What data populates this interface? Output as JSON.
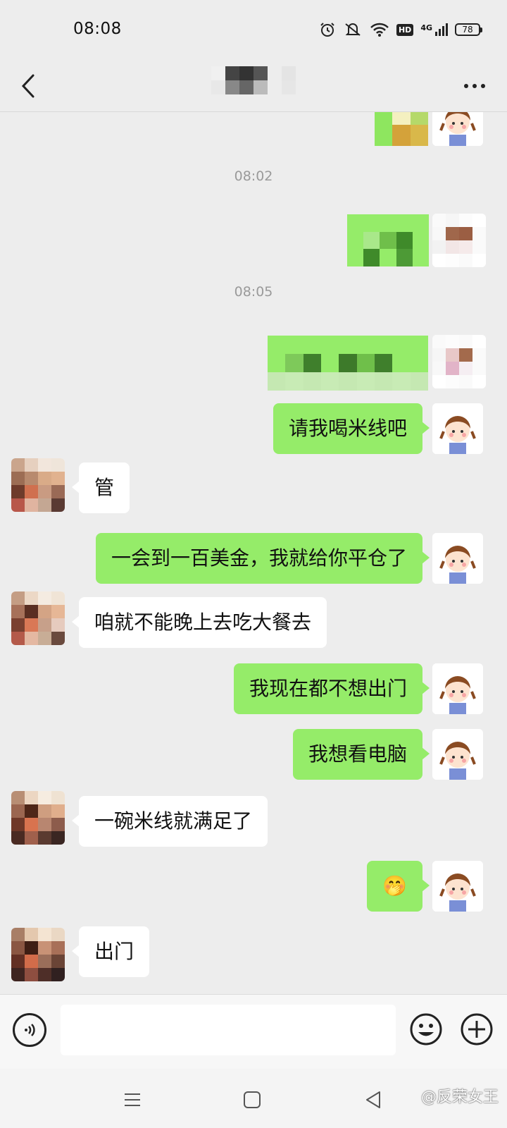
{
  "status_bar": {
    "time": "08:08",
    "battery": "78",
    "network": "4G",
    "hd": "HD",
    "icons": [
      "alarm-icon",
      "mute-icon",
      "wifi-icon",
      "hd-icon",
      "signal-icon",
      "battery-icon"
    ]
  },
  "nav": {
    "back_icon": "chevron-left-icon",
    "title": "",
    "more_icon": "more-icon"
  },
  "timestamps": [
    "08:02",
    "08:05"
  ],
  "messages": [
    {
      "side": "out",
      "type": "sticker",
      "text": ""
    },
    {
      "side": "out",
      "type": "sticker",
      "text": ""
    },
    {
      "side": "out",
      "type": "sticker",
      "text": ""
    },
    {
      "side": "out",
      "type": "text",
      "text": "请我喝米线吧"
    },
    {
      "side": "in",
      "type": "text",
      "text": "管"
    },
    {
      "side": "out",
      "type": "text",
      "text": "一会到一百美金，我就给你平仓了"
    },
    {
      "side": "in",
      "type": "text",
      "text": "咱就不能晚上去吃大餐去"
    },
    {
      "side": "out",
      "type": "text",
      "text": "我现在都不想出门"
    },
    {
      "side": "out",
      "type": "text",
      "text": "我想看电脑"
    },
    {
      "side": "in",
      "type": "text",
      "text": "一碗米线就满足了"
    },
    {
      "side": "out",
      "type": "emoji",
      "text": "🤭"
    },
    {
      "side": "in",
      "type": "text",
      "text": "出门"
    }
  ],
  "input_bar": {
    "voice_icon": "voice-icon",
    "placeholder": "",
    "emoji_icon": "emoji-icon",
    "plus_icon": "plus-icon"
  },
  "system_nav": {
    "icons": [
      "menu-icon",
      "home-icon",
      "back-triangle-icon"
    ],
    "watermark": "@反荣女王"
  },
  "colors": {
    "background": "#ededed",
    "outgoing_bubble": "#95ec69",
    "incoming_bubble": "#ffffff",
    "timestamp": "#9a9a9a"
  }
}
